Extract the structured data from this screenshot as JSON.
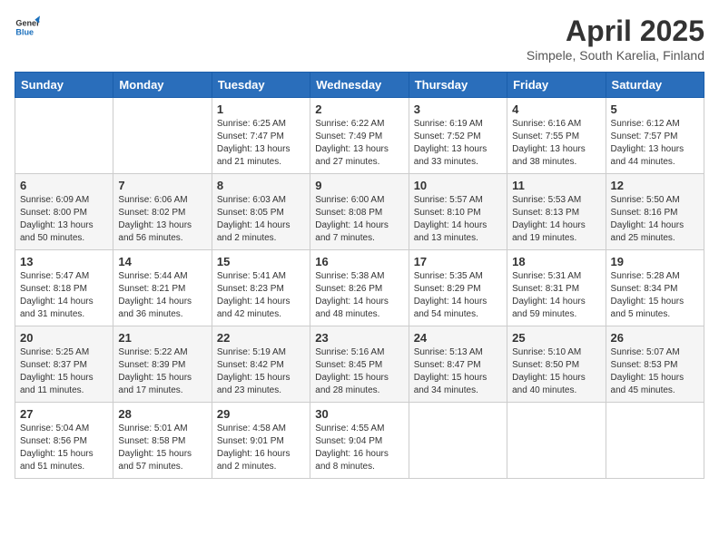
{
  "logo": {
    "text_general": "General",
    "text_blue": "Blue"
  },
  "title": "April 2025",
  "subtitle": "Simpele, South Karelia, Finland",
  "days_header": [
    "Sunday",
    "Monday",
    "Tuesday",
    "Wednesday",
    "Thursday",
    "Friday",
    "Saturday"
  ],
  "weeks": [
    [
      {
        "day": "",
        "info": ""
      },
      {
        "day": "",
        "info": ""
      },
      {
        "day": "1",
        "info": "Sunrise: 6:25 AM\nSunset: 7:47 PM\nDaylight: 13 hours and 21 minutes."
      },
      {
        "day": "2",
        "info": "Sunrise: 6:22 AM\nSunset: 7:49 PM\nDaylight: 13 hours and 27 minutes."
      },
      {
        "day": "3",
        "info": "Sunrise: 6:19 AM\nSunset: 7:52 PM\nDaylight: 13 hours and 33 minutes."
      },
      {
        "day": "4",
        "info": "Sunrise: 6:16 AM\nSunset: 7:55 PM\nDaylight: 13 hours and 38 minutes."
      },
      {
        "day": "5",
        "info": "Sunrise: 6:12 AM\nSunset: 7:57 PM\nDaylight: 13 hours and 44 minutes."
      }
    ],
    [
      {
        "day": "6",
        "info": "Sunrise: 6:09 AM\nSunset: 8:00 PM\nDaylight: 13 hours and 50 minutes."
      },
      {
        "day": "7",
        "info": "Sunrise: 6:06 AM\nSunset: 8:02 PM\nDaylight: 13 hours and 56 minutes."
      },
      {
        "day": "8",
        "info": "Sunrise: 6:03 AM\nSunset: 8:05 PM\nDaylight: 14 hours and 2 minutes."
      },
      {
        "day": "9",
        "info": "Sunrise: 6:00 AM\nSunset: 8:08 PM\nDaylight: 14 hours and 7 minutes."
      },
      {
        "day": "10",
        "info": "Sunrise: 5:57 AM\nSunset: 8:10 PM\nDaylight: 14 hours and 13 minutes."
      },
      {
        "day": "11",
        "info": "Sunrise: 5:53 AM\nSunset: 8:13 PM\nDaylight: 14 hours and 19 minutes."
      },
      {
        "day": "12",
        "info": "Sunrise: 5:50 AM\nSunset: 8:16 PM\nDaylight: 14 hours and 25 minutes."
      }
    ],
    [
      {
        "day": "13",
        "info": "Sunrise: 5:47 AM\nSunset: 8:18 PM\nDaylight: 14 hours and 31 minutes."
      },
      {
        "day": "14",
        "info": "Sunrise: 5:44 AM\nSunset: 8:21 PM\nDaylight: 14 hours and 36 minutes."
      },
      {
        "day": "15",
        "info": "Sunrise: 5:41 AM\nSunset: 8:23 PM\nDaylight: 14 hours and 42 minutes."
      },
      {
        "day": "16",
        "info": "Sunrise: 5:38 AM\nSunset: 8:26 PM\nDaylight: 14 hours and 48 minutes."
      },
      {
        "day": "17",
        "info": "Sunrise: 5:35 AM\nSunset: 8:29 PM\nDaylight: 14 hours and 54 minutes."
      },
      {
        "day": "18",
        "info": "Sunrise: 5:31 AM\nSunset: 8:31 PM\nDaylight: 14 hours and 59 minutes."
      },
      {
        "day": "19",
        "info": "Sunrise: 5:28 AM\nSunset: 8:34 PM\nDaylight: 15 hours and 5 minutes."
      }
    ],
    [
      {
        "day": "20",
        "info": "Sunrise: 5:25 AM\nSunset: 8:37 PM\nDaylight: 15 hours and 11 minutes."
      },
      {
        "day": "21",
        "info": "Sunrise: 5:22 AM\nSunset: 8:39 PM\nDaylight: 15 hours and 17 minutes."
      },
      {
        "day": "22",
        "info": "Sunrise: 5:19 AM\nSunset: 8:42 PM\nDaylight: 15 hours and 23 minutes."
      },
      {
        "day": "23",
        "info": "Sunrise: 5:16 AM\nSunset: 8:45 PM\nDaylight: 15 hours and 28 minutes."
      },
      {
        "day": "24",
        "info": "Sunrise: 5:13 AM\nSunset: 8:47 PM\nDaylight: 15 hours and 34 minutes."
      },
      {
        "day": "25",
        "info": "Sunrise: 5:10 AM\nSunset: 8:50 PM\nDaylight: 15 hours and 40 minutes."
      },
      {
        "day": "26",
        "info": "Sunrise: 5:07 AM\nSunset: 8:53 PM\nDaylight: 15 hours and 45 minutes."
      }
    ],
    [
      {
        "day": "27",
        "info": "Sunrise: 5:04 AM\nSunset: 8:56 PM\nDaylight: 15 hours and 51 minutes."
      },
      {
        "day": "28",
        "info": "Sunrise: 5:01 AM\nSunset: 8:58 PM\nDaylight: 15 hours and 57 minutes."
      },
      {
        "day": "29",
        "info": "Sunrise: 4:58 AM\nSunset: 9:01 PM\nDaylight: 16 hours and 2 minutes."
      },
      {
        "day": "30",
        "info": "Sunrise: 4:55 AM\nSunset: 9:04 PM\nDaylight: 16 hours and 8 minutes."
      },
      {
        "day": "",
        "info": ""
      },
      {
        "day": "",
        "info": ""
      },
      {
        "day": "",
        "info": ""
      }
    ]
  ]
}
